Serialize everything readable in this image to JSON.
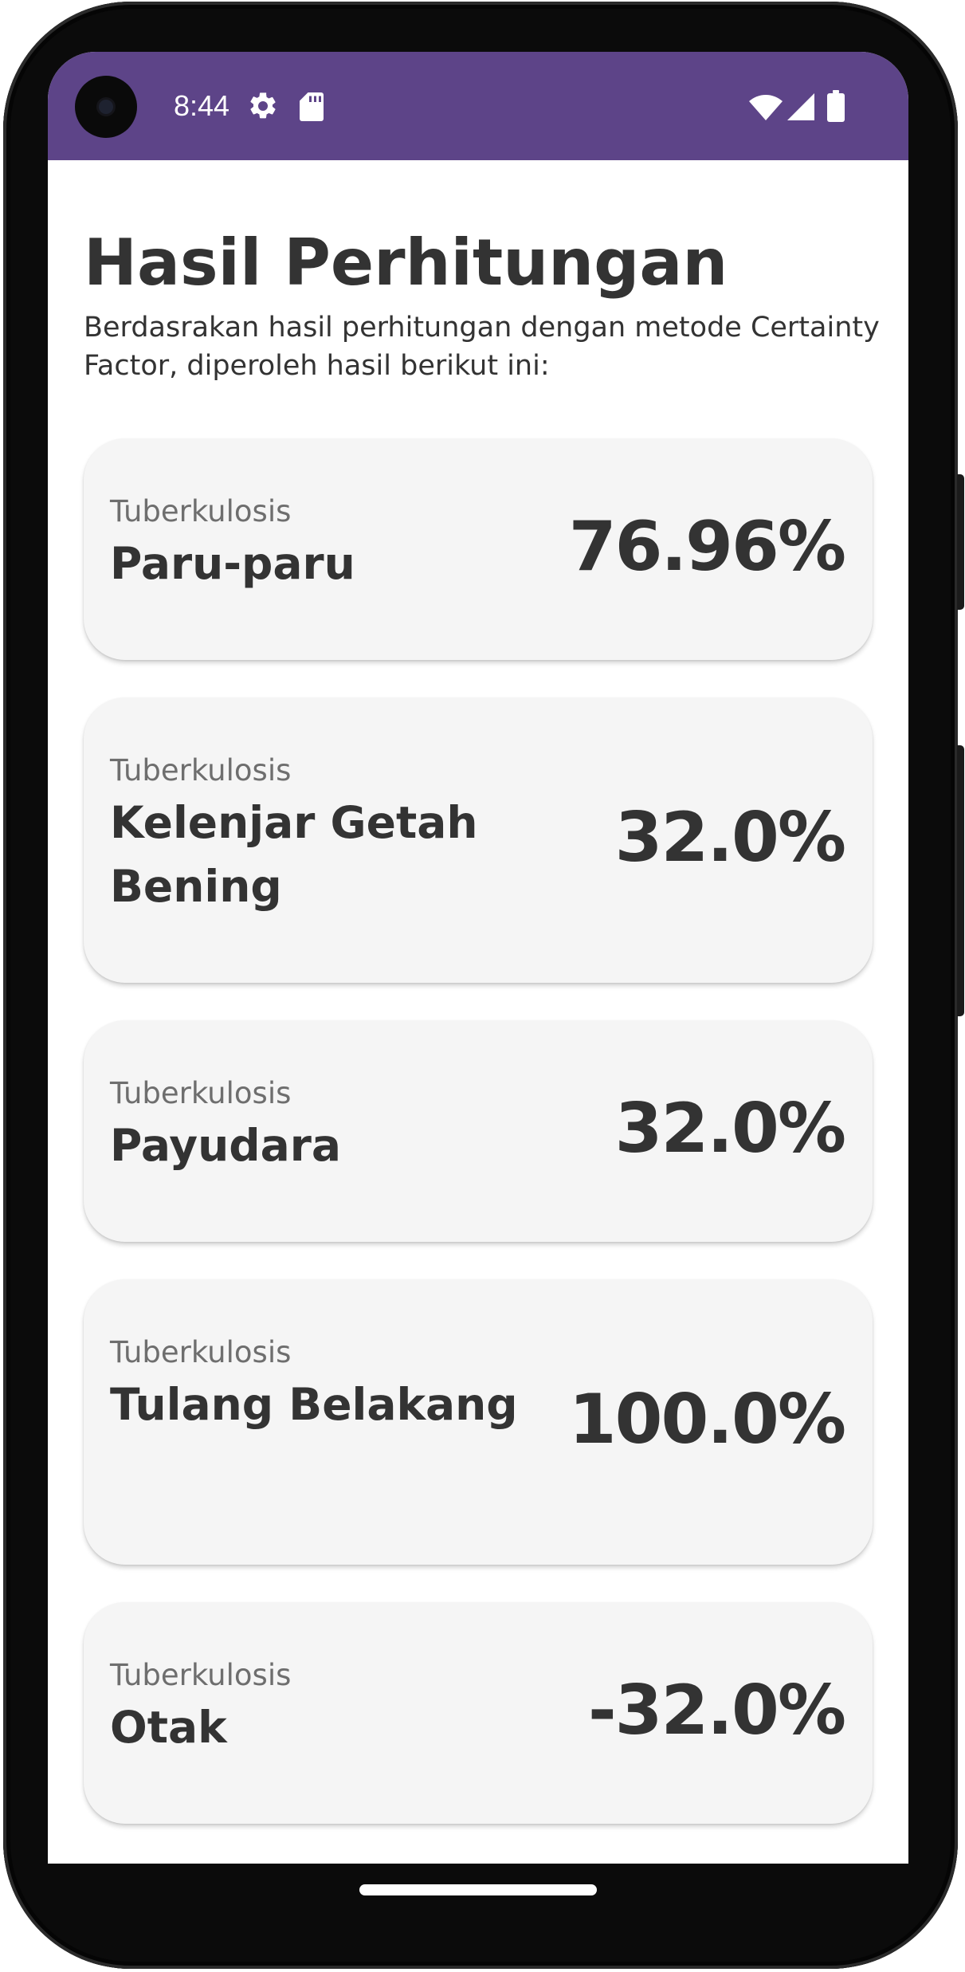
{
  "status_bar": {
    "time": "8:44",
    "background": "#5d4488",
    "icons": [
      "settings-icon",
      "sd-card-icon",
      "wifi-icon",
      "cell-signal-icon",
      "battery-icon"
    ]
  },
  "header": {
    "title": "Hasil Perhitungan",
    "subtitle": "Berdasrakan hasil perhitungan dengan metode Certainty Factor, diperoleh hasil berikut ini:"
  },
  "results": [
    {
      "category": "Tuberkulosis",
      "name": "Paru-paru",
      "value": "76.96%"
    },
    {
      "category": "Tuberkulosis",
      "name": "Kelenjar Getah Bening",
      "value": "32.0%"
    },
    {
      "category": "Tuberkulosis",
      "name": "Payudara",
      "value": "32.0%"
    },
    {
      "category": "Tuberkulosis",
      "name": "Tulang Belakang",
      "value": "100.0%"
    },
    {
      "category": "Tuberkulosis",
      "name": "Otak",
      "value": "-32.0%"
    }
  ],
  "colors": {
    "accent": "#5d4488",
    "card_background": "#f5f5f5",
    "text_primary": "#333333",
    "text_secondary": "#6e6e6e"
  }
}
